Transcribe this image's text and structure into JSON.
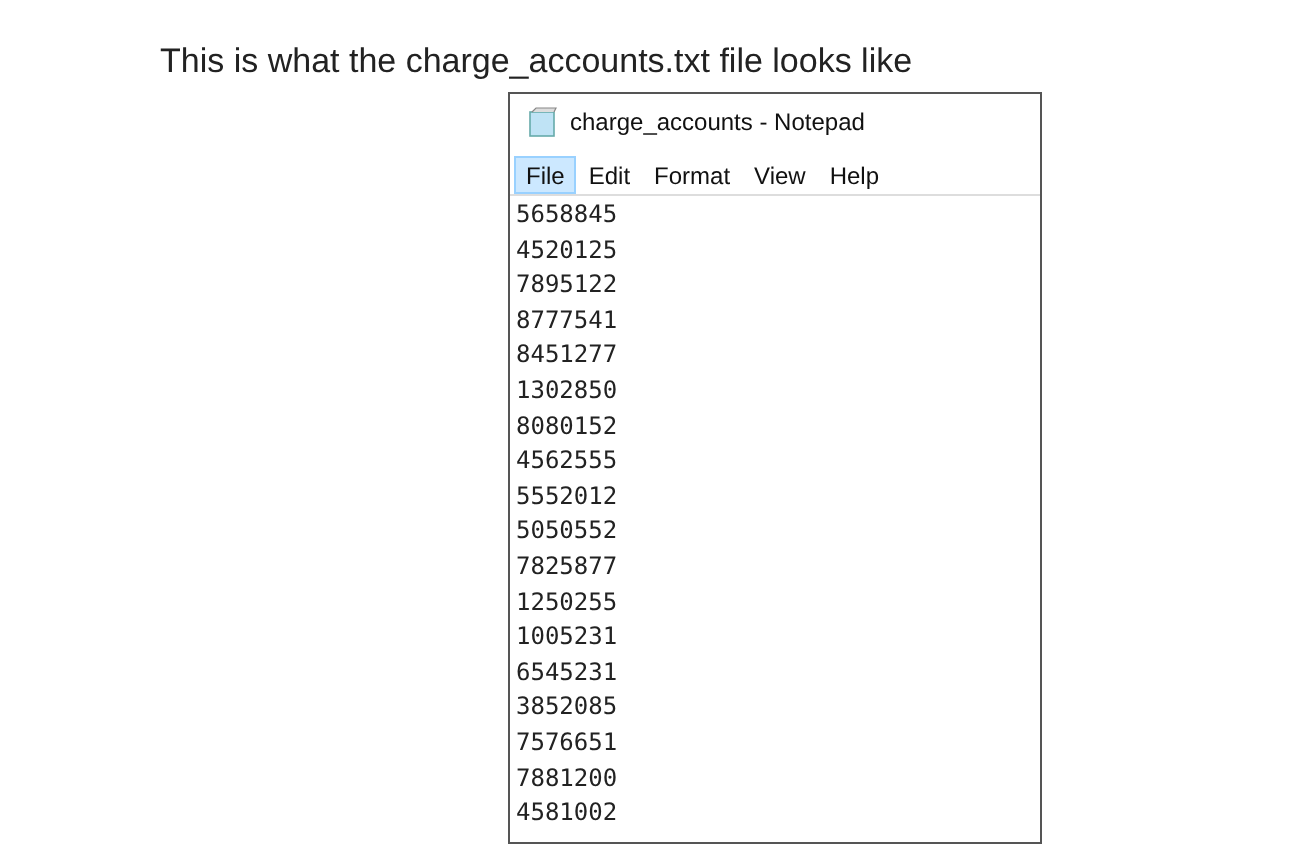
{
  "caption": "This is what the charge_accounts.txt file looks like",
  "window": {
    "title": "charge_accounts - Notepad"
  },
  "menu": [
    {
      "label": "File",
      "selected": true
    },
    {
      "label": "Edit",
      "selected": false
    },
    {
      "label": "Format",
      "selected": false
    },
    {
      "label": "View",
      "selected": false
    },
    {
      "label": "Help",
      "selected": false
    }
  ],
  "lines": [
    "5658845",
    "4520125",
    "7895122",
    "8777541",
    "8451277",
    "1302850",
    "8080152",
    "4562555",
    "5552012",
    "5050552",
    "7825877",
    "1250255",
    "1005231",
    "6545231",
    "3852085",
    "7576651",
    "7881200",
    "4581002"
  ]
}
